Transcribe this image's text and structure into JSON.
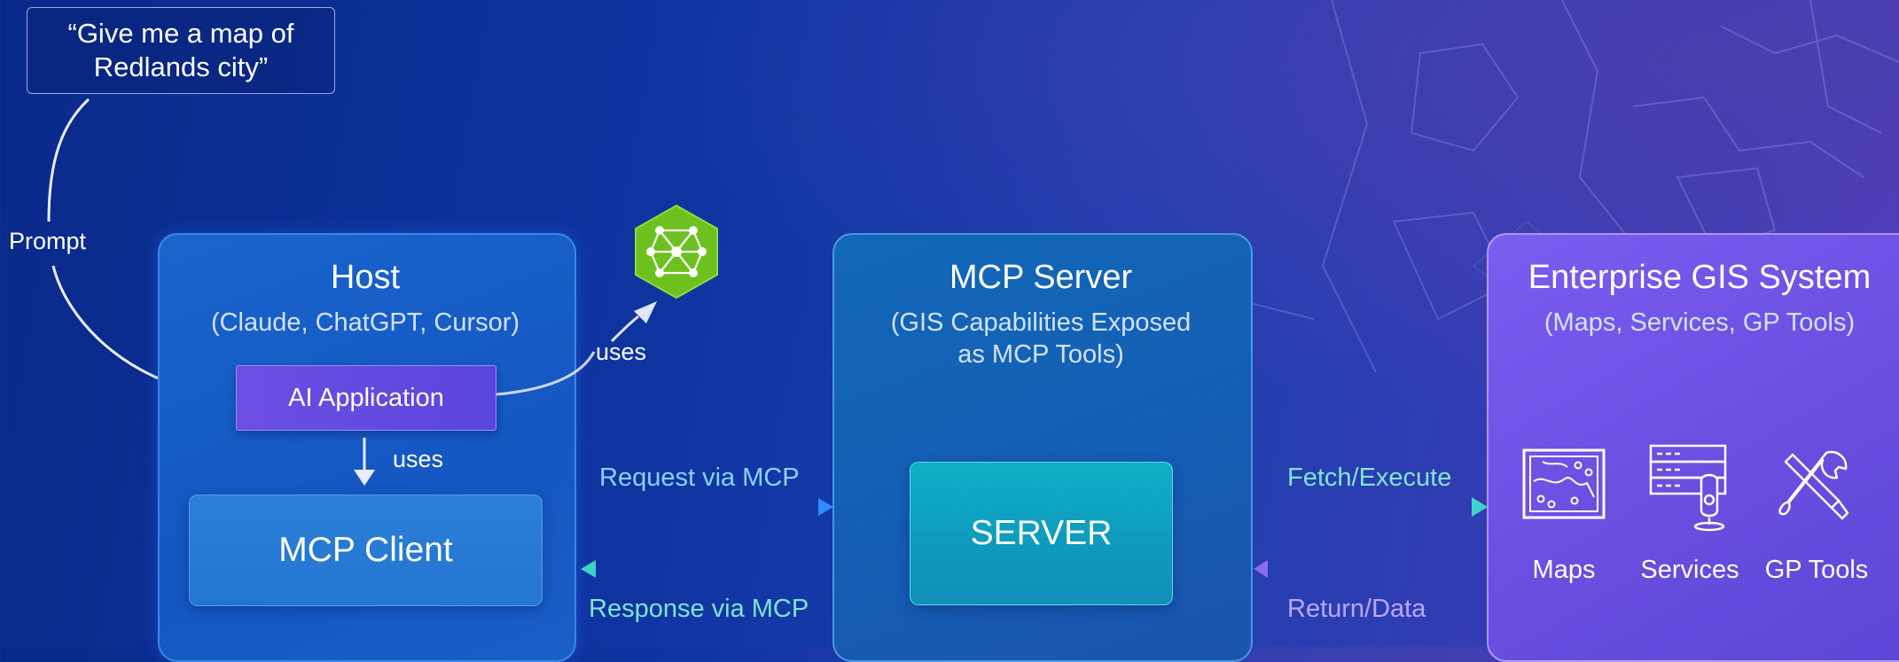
{
  "prompt": {
    "quote": "“Give me a map of\nRedlands city”",
    "label": "Prompt"
  },
  "host": {
    "title": "Host",
    "subtitle": "(Claude, ChatGPT, Cursor)",
    "ai_application": "AI Application",
    "uses_llm": "uses",
    "uses_client": "uses",
    "mcp_client": "MCP Client"
  },
  "llm_icon": "neural-network-icon",
  "mcp_server": {
    "title": "MCP Server",
    "subtitle": "(GIS Capabilities Exposed\nas MCP Tools)",
    "server_label": "SERVER"
  },
  "flows": {
    "request": "Request via MCP",
    "response": "Response via MCP",
    "fetch": "Fetch/Execute",
    "return": "Return/Data"
  },
  "gis": {
    "title": "Enterprise GIS System",
    "subtitle": "(Maps, Services, GP Tools)",
    "items": [
      {
        "label": "Maps",
        "icon": "map-icon"
      },
      {
        "label": "Services",
        "icon": "server-stack-icon"
      },
      {
        "label": "GP Tools",
        "icon": "tools-icon"
      }
    ]
  },
  "colors": {
    "request_arrow": "#2f8cff",
    "response_arrow": "#3ad6c4",
    "fetch_arrow": "#3fd3c9",
    "return_arrow": "#8a6cf0",
    "llm_hex": "#6cc11f"
  }
}
